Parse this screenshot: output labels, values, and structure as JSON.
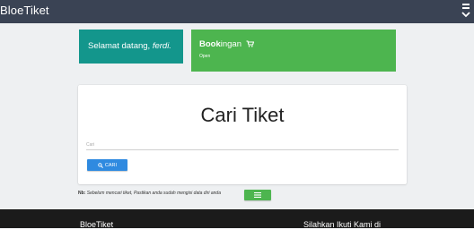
{
  "navbar": {
    "brand": "BloeTiket",
    "menu_icon": "hamburger-chevron-icon"
  },
  "welcome": {
    "greeting": "Selamat datang, ",
    "username": "ferdi."
  },
  "booking": {
    "title_bold": "Book",
    "title_rest": "ingan",
    "icon": "cart-icon",
    "status": "Open"
  },
  "search": {
    "title": "Cari Tiket",
    "placeholder": "Cari",
    "value": "",
    "button_label": "CARI",
    "button_icon": "search-icon"
  },
  "note": {
    "prefix": "Nb:",
    "text": " Sebelum mencari tiket, Pastikan anda sudah mengisi data diri anda",
    "button_icon": "list-icon"
  },
  "footer": {
    "brand": "BloeTiket",
    "follow_text": "Silahkan Ikuti Kami di"
  },
  "colors": {
    "navbar": "#3a4354",
    "welcome": "#13968c",
    "booking": "#4db54f",
    "primary": "#2f8ae0",
    "footer": "#1b1b1b"
  }
}
